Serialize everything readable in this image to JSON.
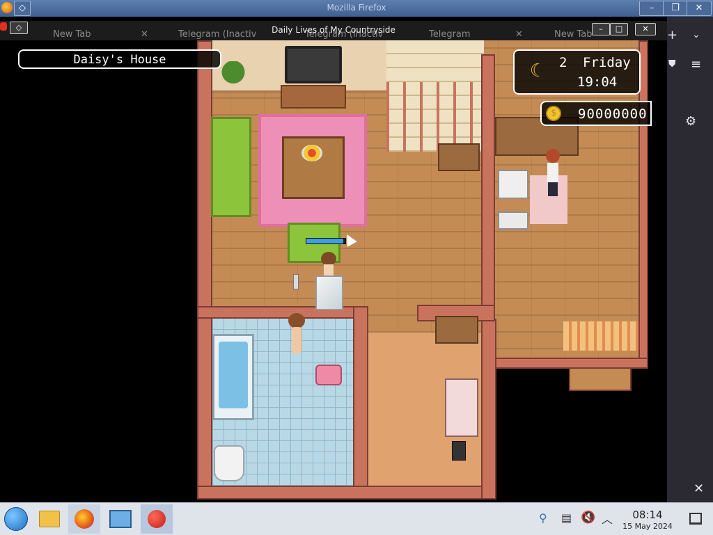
{
  "firefox": {
    "title": "Mozilla Firefox",
    "tabs": [
      {
        "label": "New Tab"
      },
      {
        "label": "Telegram (Inactiv"
      },
      {
        "label": "Telegram (Inactiv"
      },
      {
        "label": "Telegram"
      },
      {
        "label": "New Tab"
      }
    ]
  },
  "game": {
    "window_title": "Daily Lives of My Countryside",
    "hud": {
      "location": "Daisy's House",
      "day": "2",
      "weekday": "Friday",
      "time": "19:04",
      "gold": "90000000"
    },
    "player_stamina_fraction": 0.95
  },
  "taskbar": {
    "time": "08:14",
    "date": "15 May 2024"
  }
}
